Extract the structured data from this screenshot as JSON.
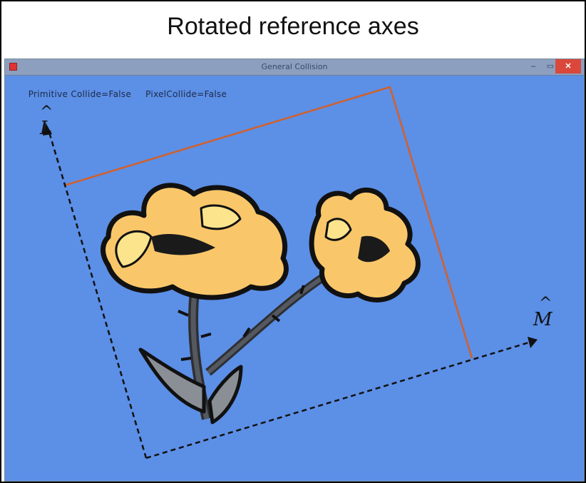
{
  "slide": {
    "title": "Rotated reference axes"
  },
  "window": {
    "title": "General Collision",
    "buttons": {
      "minimize": "–",
      "maximize": "▭",
      "close": "✕"
    }
  },
  "status": {
    "primitive": "Primitive Collide=False",
    "pixel": "PixelCollide=False"
  },
  "axes": {
    "vertical_label": "L",
    "horizontal_label": "M",
    "hat": "^"
  },
  "colors": {
    "background": "#5c8fe6",
    "bounding_box": "#d2602b",
    "axis": "#111111",
    "petal": "#f9c76a",
    "petal_highlight": "#fbe48c",
    "leaf": "#8a8f96",
    "stem": "#4a4f55"
  },
  "icons": {
    "app": "app-icon",
    "bounding_box": "rotated-bounding-box",
    "sprite": "flower-sprite"
  }
}
